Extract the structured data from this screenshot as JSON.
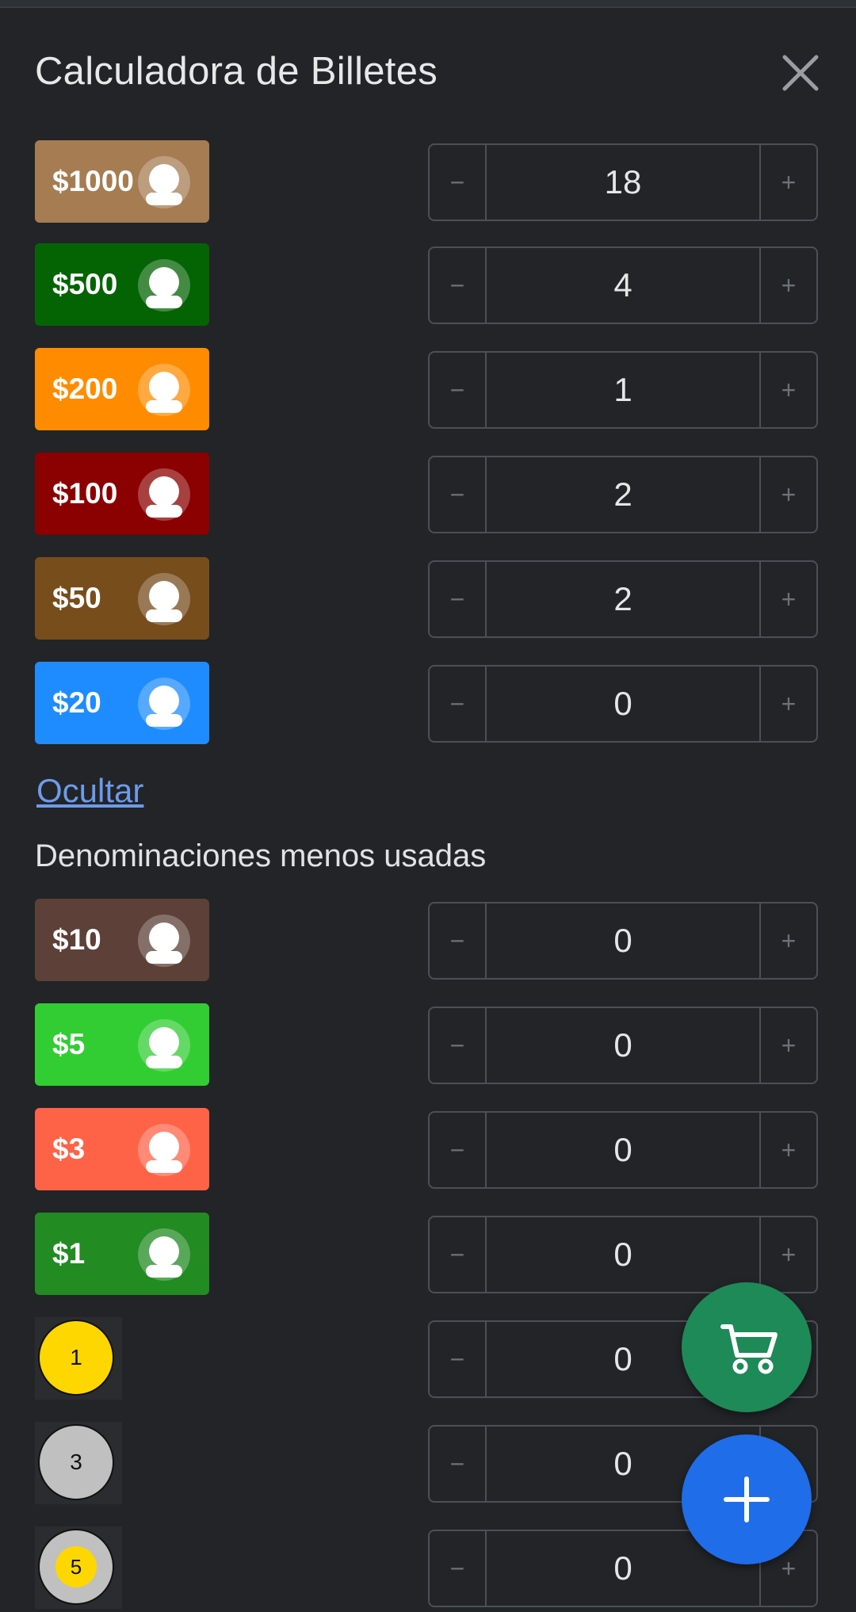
{
  "dialog": {
    "title": "Calculadora de Billetes",
    "close_icon": "close-icon"
  },
  "bills": [
    {
      "label": "$1000",
      "count": "18",
      "color": "#a67c52"
    },
    {
      "label": "$500",
      "count": "4",
      "color": "#046404"
    },
    {
      "label": "$200",
      "count": "1",
      "color": "#ff8c00"
    },
    {
      "label": "$100",
      "count": "2",
      "color": "#8b0000"
    },
    {
      "label": "$50",
      "count": "2",
      "color": "#774d1c"
    },
    {
      "label": "$20",
      "count": "0",
      "color": "#1e8cff"
    }
  ],
  "hide_link": "Ocultar",
  "less_used_title": "Denominaciones menos usadas",
  "less_used_bills": [
    {
      "label": "$10",
      "count": "0",
      "color": "#5d4037"
    },
    {
      "label": "$5",
      "count": "0",
      "color": "#32cd32"
    },
    {
      "label": "$3",
      "count": "0",
      "color": "#ff6347"
    },
    {
      "label": "$1",
      "count": "0",
      "color": "#228b22"
    }
  ],
  "coins": [
    {
      "label": "1",
      "count": "0",
      "color": "#ffd700"
    },
    {
      "label": "3",
      "count": "0",
      "color": "#c0c0c0"
    },
    {
      "label": "5",
      "count": "0",
      "color": "#c0c0c0",
      "inner_color": "#ffd700"
    }
  ],
  "stepper": {
    "minus": "−",
    "plus": "+"
  },
  "fabs": {
    "cart_icon": "shopping-cart-icon",
    "add_icon": "plus-icon"
  }
}
